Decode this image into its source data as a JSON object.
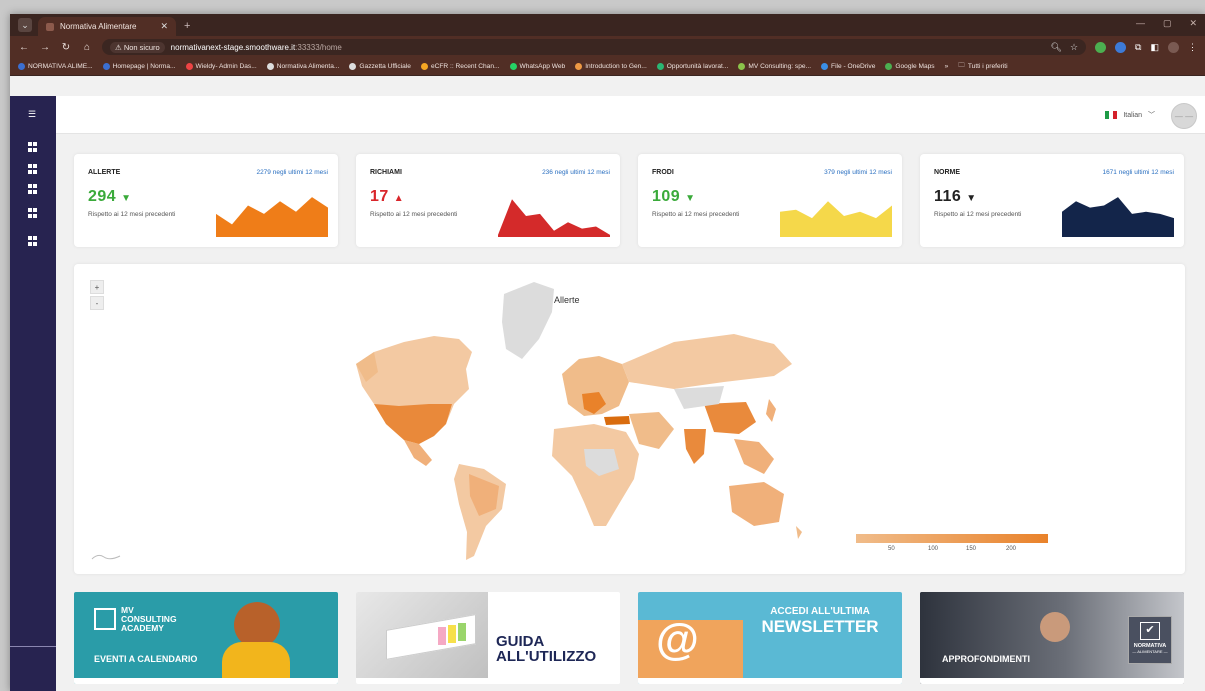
{
  "browser": {
    "tab_title": "Normativa Alimentare",
    "url_warning": "Non sicuro",
    "url_host": "normativanext-stage.smoothware.it",
    "url_path": ":33333/home",
    "bookmarks": [
      {
        "label": "NORMATIVA ALIME...",
        "color": "#3b6fd1"
      },
      {
        "label": "Homepage | Norma...",
        "color": "#3b6fd1"
      },
      {
        "label": "Wieldy- Admin Das...",
        "color": "#e44"
      },
      {
        "label": "Normativa Alimenta...",
        "color": "#ddd"
      },
      {
        "label": "Gazzetta Ufficiale",
        "color": "#ddd"
      },
      {
        "label": "eCFR :: Recent Chan...",
        "color": "#f5a623"
      },
      {
        "label": "WhatsApp Web",
        "color": "#25d366"
      },
      {
        "label": "Introduction to Gen...",
        "color": "#e94"
      },
      {
        "label": "Opportunità lavorat...",
        "color": "#2bb673"
      },
      {
        "label": "MV Consulting: spe...",
        "color": "#8bc34a"
      },
      {
        "label": "File - OneDrive",
        "color": "#3a8ee6"
      },
      {
        "label": "Google Maps",
        "color": "#4caf50"
      }
    ],
    "bookmarks_overflow": "»",
    "all_bookmarks": "Tutti i preferiti"
  },
  "topbar": {
    "language": "Italian"
  },
  "stats": [
    {
      "label": "ALLERTE",
      "sub": "2279 negli ultimi 12 mesi",
      "value": "294",
      "trend": "down",
      "trend_color": "#3aaa3a",
      "value_color": "#3aaa3a",
      "desc": "Rispetto ai 12 mesi precedenti",
      "spark_color": "#ef7d18",
      "spark": [
        0.55,
        0.3,
        0.75,
        0.55,
        0.85,
        0.6,
        0.95,
        0.7
      ]
    },
    {
      "label": "RICHIAMI",
      "sub": "236 negli ultimi 12 mesi",
      "value": "17",
      "trend": "up",
      "trend_color": "#d9262b",
      "value_color": "#d9262b",
      "desc": "Rispetto ai 12 mesi precedenti",
      "spark_color": "#d42a2a",
      "spark": [
        0.05,
        0.9,
        0.5,
        0.55,
        0.15,
        0.35,
        0.2,
        0.25,
        0.05
      ]
    },
    {
      "label": "FRODI",
      "sub": "379 negli ultimi 12 mesi",
      "value": "109",
      "trend": "down",
      "trend_color": "#3aaa3a",
      "value_color": "#3aaa3a",
      "desc": "Rispetto ai 12 mesi precedenti",
      "spark_color": "#f5d84a",
      "spark": [
        0.6,
        0.65,
        0.45,
        0.85,
        0.5,
        0.6,
        0.45,
        0.75
      ]
    },
    {
      "label": "NORME",
      "sub": "1671 negli ultimi 12 mesi",
      "value": "116",
      "trend": "down",
      "trend_color": "#222",
      "value_color": "#222",
      "desc": "Rispetto ai 12 mesi precedenti",
      "spark_color": "#13254a",
      "spark": [
        0.6,
        0.85,
        0.7,
        0.75,
        0.95,
        0.55,
        0.6,
        0.55,
        0.45
      ]
    }
  ],
  "map": {
    "title": "Allerte",
    "zoom_in": "+",
    "zoom_out": "-",
    "legend_ticks": [
      "50",
      "100",
      "150",
      "200"
    ],
    "legend_min_color": "#f0bc8a",
    "legend_max_color": "#e9822a"
  },
  "banners": [
    {
      "name": "eventi",
      "title_line1": "MV",
      "title_line2": "CONSULTING",
      "title_line3": "ACADEMY",
      "caption": "EVENTI A CALENDARIO",
      "bg": "#2a9ca8"
    },
    {
      "name": "guida",
      "caption_line1": "GUIDA",
      "caption_line2": "ALL'UTILIZZO",
      "bg": "#ffffff"
    },
    {
      "name": "newsletter",
      "caption_line1": "ACCEDI ALL'ULTIMA",
      "caption_line2": "NEWSLETTER",
      "bg": "#5ab9d4"
    },
    {
      "name": "approfondimenti",
      "caption": "APPROFONDIMENTI",
      "logo_line1": "NORMATIVA",
      "logo_line2": "— ALIMENTARE —",
      "bg": "#3a3f4c"
    }
  ]
}
